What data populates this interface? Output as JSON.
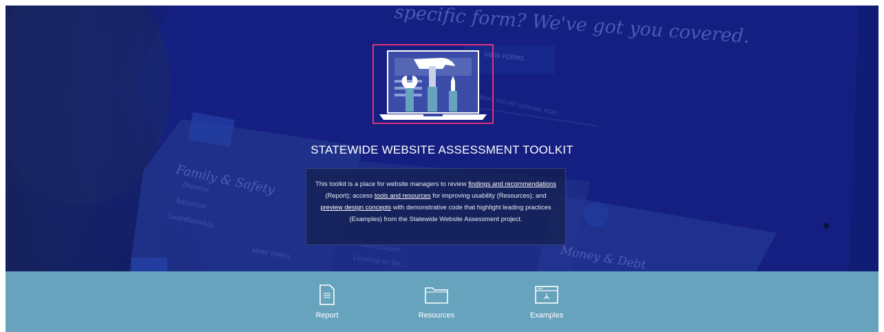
{
  "background": {
    "headline": "specific form? We've got you covered.",
    "view_forms_button": "VIEW FORMS",
    "search_prompt": "CAN'T FIND WHAT YOU'RE LOOKING FOR?",
    "cards": [
      {
        "title": "Family & Safety",
        "items": [
          "Divorce",
          "Adoption",
          "Guardianship"
        ],
        "more": "MORE TOPICS"
      },
      {
        "title": "Money & Debt"
      }
    ],
    "middle_card_items": [
      "Foreclosure",
      "Leasing or Re..."
    ]
  },
  "hero": {
    "title": "STATEWIDE WEBSITE ASSESSMENT TOOLKIT",
    "description": {
      "t1": "This toolkit is a place for website managers to review ",
      "l1": "findings and recommendations",
      "t2": " (Report); access ",
      "l2": "tools and resources",
      "t3": " for improving usability (Resources); and ",
      "l3": "preview design concepts",
      "t4": " with demonstrative code that highlight leading practices (Examples) from the Statewide Website Assessment project."
    }
  },
  "nav": {
    "items": [
      {
        "label": "Report",
        "icon": "document-icon"
      },
      {
        "label": "Resources",
        "icon": "folder-icon"
      },
      {
        "label": "Examples",
        "icon": "browser-window-icon"
      }
    ]
  },
  "colors": {
    "hero_bg": "#12206e",
    "logo_border": "#e0337a",
    "nav_bg": "#67a3bd"
  }
}
